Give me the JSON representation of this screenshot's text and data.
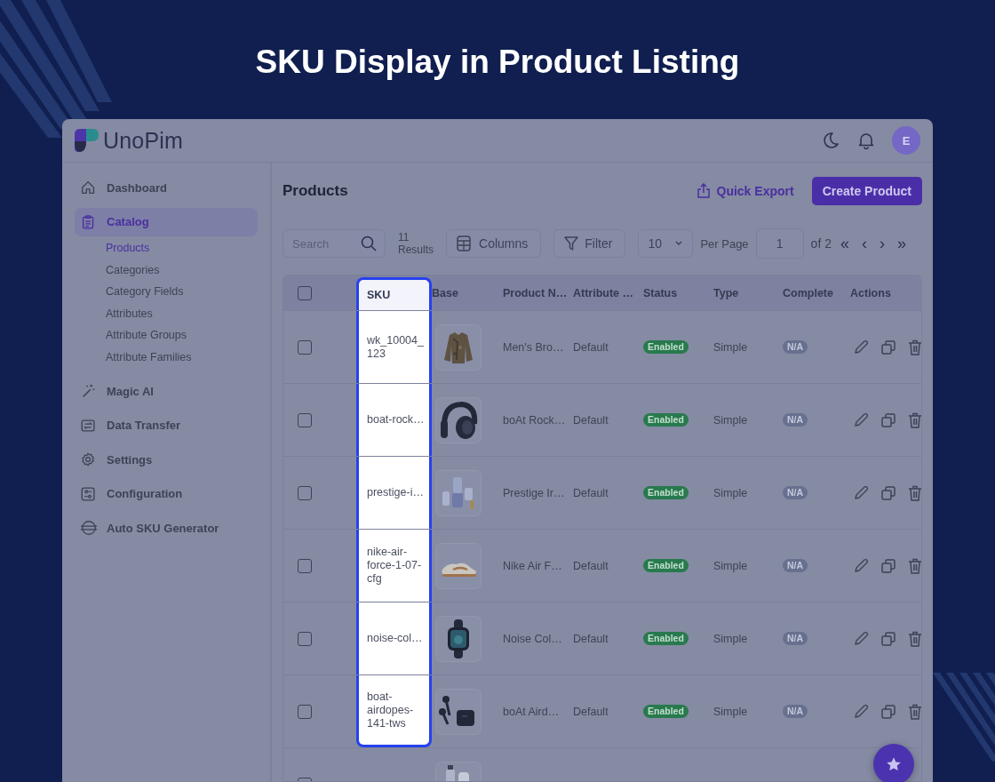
{
  "banner": {
    "title": "SKU Display in Product Listing"
  },
  "app": {
    "logo": "UnoPim",
    "avatar": "E"
  },
  "sidebar": {
    "items": [
      {
        "label": "Dashboard",
        "selected": false
      },
      {
        "label": "Catalog",
        "selected": true,
        "children": [
          {
            "label": "Products",
            "selected": true
          },
          {
            "label": "Categories",
            "selected": false
          },
          {
            "label": "Category Fields",
            "selected": false
          },
          {
            "label": "Attributes",
            "selected": false
          },
          {
            "label": "Attribute Groups",
            "selected": false
          },
          {
            "label": "Attribute Families",
            "selected": false
          }
        ]
      },
      {
        "label": "Magic AI",
        "selected": false
      },
      {
        "label": "Data Transfer",
        "selected": false
      },
      {
        "label": "Settings",
        "selected": false
      },
      {
        "label": "Configuration",
        "selected": false
      },
      {
        "label": "Auto SKU Generator",
        "selected": false
      }
    ]
  },
  "main": {
    "title": "Products",
    "quick_export": "Quick Export",
    "create_button": "Create Product",
    "search": {
      "placeholder": "Search"
    },
    "results_count": "11",
    "results_label": "Results",
    "columns_button": "Columns",
    "filter_button": "Filter",
    "per_page": {
      "value": "10",
      "label": "Per Page"
    },
    "page": {
      "value": "1",
      "total": "of 2"
    },
    "pager": [
      "«",
      "‹",
      "›",
      "»"
    ]
  },
  "table": {
    "header_checked": false,
    "columns": [
      {
        "label": "SKU",
        "highlighted": true
      },
      {
        "label": "Base",
        "highlighted": false
      },
      {
        "label": "Product N…",
        "highlighted": false
      },
      {
        "label": "Attribute …",
        "highlighted": false
      },
      {
        "label": "Status",
        "highlighted": false
      },
      {
        "label": "Type",
        "highlighted": false
      },
      {
        "label": "Complete",
        "highlighted": false
      },
      {
        "label": "Actions",
        "highlighted": false
      }
    ],
    "rows": [
      {
        "checked": false,
        "highlighted": true,
        "sku": "wk_10004_123",
        "name": "Men's Bro…",
        "family": "Default",
        "status": {
          "label": "Enabled",
          "kind": "enabled"
        },
        "type": "Simple",
        "complete": "N/A"
      },
      {
        "checked": false,
        "highlighted": true,
        "sku": "boat-rock…",
        "name": "boAt Rock…",
        "family": "Default",
        "status": {
          "label": "Enabled",
          "kind": "enabled"
        },
        "type": "Simple",
        "complete": "N/A"
      },
      {
        "checked": false,
        "highlighted": true,
        "sku": "prestige-i…",
        "name": "Prestige Ir…",
        "family": "Default",
        "status": {
          "label": "Enabled",
          "kind": "enabled"
        },
        "type": "Simple",
        "complete": "N/A"
      },
      {
        "checked": false,
        "highlighted": true,
        "sku": "nike-air-force-1-07-cfg",
        "name": "Nike Air F…",
        "family": "Default",
        "status": {
          "label": "Enabled",
          "kind": "enabled"
        },
        "type": "Simple",
        "complete": "N/A"
      },
      {
        "checked": false,
        "highlighted": true,
        "sku": "noise-col…",
        "name": "Noise Col…",
        "family": "Default",
        "status": {
          "label": "Enabled",
          "kind": "enabled"
        },
        "type": "Simple",
        "complete": "N/A"
      },
      {
        "checked": false,
        "highlighted": true,
        "sku": "boat-airdopes-141-tws",
        "name": "boAt Aird…",
        "family": "Default",
        "status": {
          "label": "Enabled",
          "kind": "enabled"
        },
        "type": "Simple",
        "complete": "N/A"
      },
      {
        "checked": false,
        "highlighted": false
      }
    ]
  }
}
